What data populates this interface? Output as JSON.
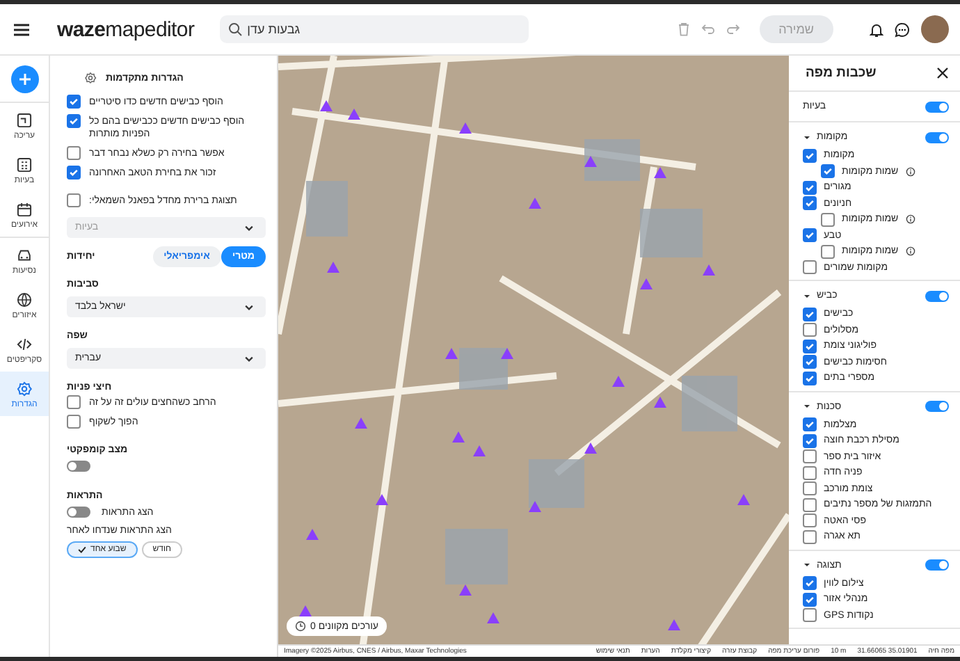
{
  "top_bar": {
    "logo": "**waze**mapeditor",
    "search": {
      "value": "גבעות עדן"
    },
    "save_button": {
      "label": "שמירה",
      "disabled": true
    }
  },
  "nav_rail": {
    "items": [
      {
        "label": "עריכה",
        "selected": false
      },
      {
        "label": "בעיות",
        "selected": false
      },
      {
        "label": "אירועים",
        "selected": false
      },
      {
        "label": "נסיעות",
        "selected": false
      },
      {
        "label": "איזורים",
        "selected": false
      },
      {
        "label": "סקריפטים",
        "selected": false
      },
      {
        "label": "הגדרות",
        "selected": true
      }
    ]
  },
  "settings": {
    "title": "הגדרות מתקדמות",
    "options": [
      {
        "label": "הוסף כבישים חדשים כדו סיטריים",
        "checked": true
      },
      {
        "label": "הוסף כבישים חדשים ככבישים בהם כל הפניות מותרות",
        "checked": true
      },
      {
        "label": "אפשר בחירה רק כשלא נבחר דבר",
        "checked": false
      },
      {
        "label": "זכור את בחירת הטאב האחרונה",
        "checked": true
      }
    ],
    "default_panel": {
      "label": "תצוגת ברירת מחדל בפאנל השמאלי:",
      "checked": false,
      "placeholder": "בעיות"
    },
    "units": {
      "label": "יחידות",
      "options": [
        {
          "label": "מטרי",
          "selected": true
        },
        {
          "label": "אימפריאלי",
          "selected": false
        }
      ]
    },
    "environment": {
      "label": "סביבות",
      "value": "ישראל בלבד"
    },
    "language": {
      "label": "שפה",
      "value": "עברית"
    },
    "turn_arrows": {
      "label": "חיצי פניות",
      "options": [
        {
          "label": "הרחב כשהחצים עולים זה על זה",
          "checked": false
        },
        {
          "label": "הפוך לשקוף",
          "checked": false
        }
      ]
    },
    "compact_mode": {
      "label": "מצב קומפקטי",
      "on": false
    },
    "notifications": {
      "label": "התראות",
      "toggle_label": "הצג התראות",
      "on": false,
      "snooze_label": "הצג התראות שנדחו לאחר",
      "snooze_options": [
        {
          "label": "חודש",
          "selected": false
        },
        {
          "label": "שבוע אחד",
          "selected": true
        }
      ]
    }
  },
  "map": {
    "online_editors": "עורכים מקוונים 0"
  },
  "layers": {
    "title": "שכבות מפה",
    "groups": [
      {
        "label": "בעיות",
        "on": true,
        "expanded": false
      },
      {
        "label": "מקומות",
        "on": true,
        "expanded": true,
        "items": [
          {
            "label": "מקומות",
            "checked": true,
            "children": [
              {
                "label": "שמות מקומות",
                "checked": true
              }
            ]
          },
          {
            "label": "מגורים",
            "checked": true
          },
          {
            "label": "חניונים",
            "checked": true,
            "children": [
              {
                "label": "שמות מקומות",
                "checked": false
              }
            ]
          },
          {
            "label": "טבע",
            "checked": true,
            "children": [
              {
                "label": "שמות מקומות",
                "checked": false
              }
            ]
          },
          {
            "label": "מקומות שמורים",
            "checked": false
          }
        ]
      },
      {
        "label": "כביש",
        "on": true,
        "expanded": true,
        "items": [
          {
            "label": "כבישים",
            "checked": true
          },
          {
            "label": "מסלולים",
            "checked": false
          },
          {
            "label": "פוליגוני צומת",
            "checked": true
          },
          {
            "label": "חסימות כבישים",
            "checked": true
          },
          {
            "label": "מספרי בתים",
            "checked": true
          }
        ]
      },
      {
        "label": "סכנות",
        "on": true,
        "expanded": true,
        "items": [
          {
            "label": "מצלמות",
            "checked": true
          },
          {
            "label": "מסילת רכבת חוצה",
            "checked": true
          },
          {
            "label": "איזור בית ספר",
            "checked": false
          },
          {
            "label": "פניה חדה",
            "checked": false
          },
          {
            "label": "צומת מורכב",
            "checked": false
          },
          {
            "label": "התמזגות של מספר נתיבים",
            "checked": false
          },
          {
            "label": "פסי האטה",
            "checked": false
          },
          {
            "label": "תא אגרה",
            "checked": false
          }
        ]
      },
      {
        "label": "תצוגה",
        "on": true,
        "expanded": true,
        "items": [
          {
            "label": "צילום לווין",
            "checked": true
          },
          {
            "label": "מנהלי אזור",
            "checked": true
          },
          {
            "label": "נקודות GPS",
            "checked": false
          }
        ]
      }
    ]
  },
  "footer": {
    "imagery": "Imagery ©2025 Airbus, CNES / Airbus, Maxar Technologies",
    "links": [
      "מפה חיה",
      "31.66065 35.01901",
      "10 m",
      "פורום עריכת מפה",
      "קבוצת עזרה",
      "קיצורי מקלדת",
      "הערות",
      "תנאי שימוש"
    ]
  }
}
